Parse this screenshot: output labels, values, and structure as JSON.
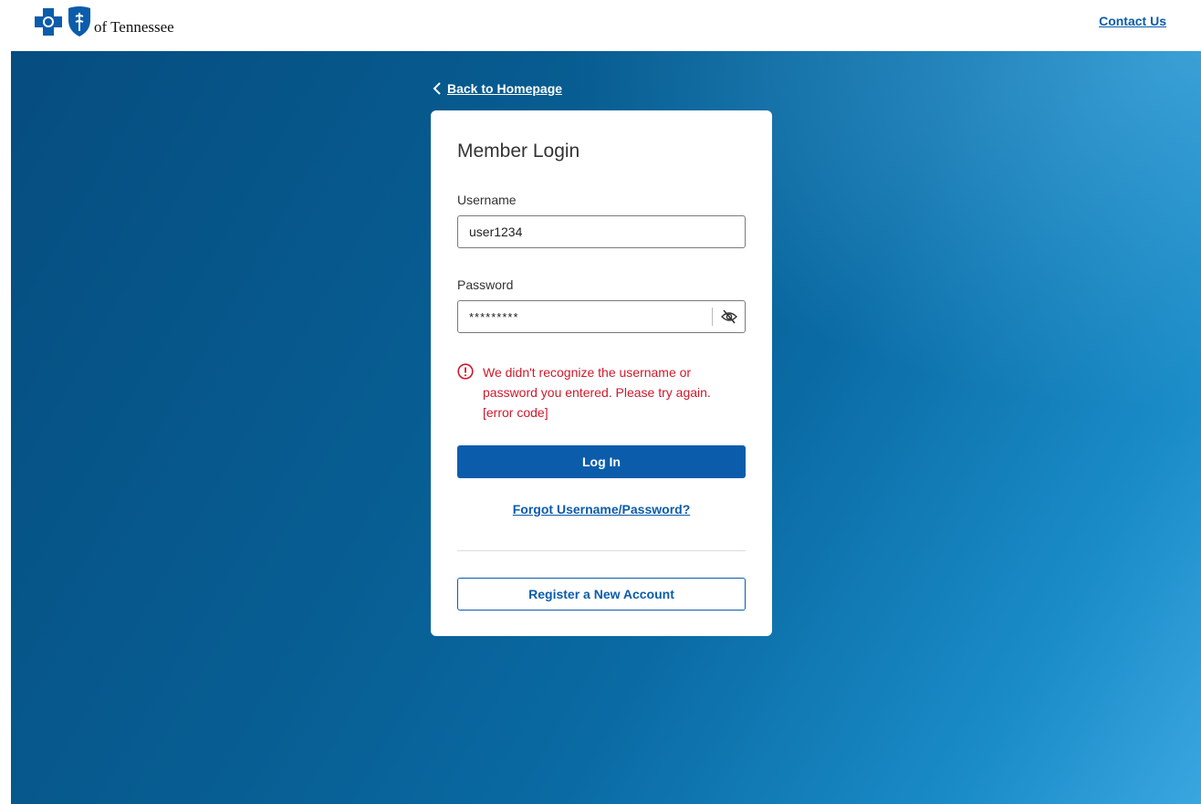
{
  "header": {
    "brand_text": "of Tennessee",
    "contact_label": "Contact Us"
  },
  "back_link": {
    "label": "Back to Homepage",
    "icon": "chevron-left-icon"
  },
  "login_card": {
    "title": "Member Login",
    "username": {
      "label": "Username",
      "value": "user1234"
    },
    "password": {
      "label": "Password",
      "value": "*********",
      "toggle_icon": "eye-slash-icon"
    },
    "error": {
      "icon": "alert-circle-icon",
      "lines": [
        "We didn't recognize the username or",
        "password you entered. Please try again.",
        "[error code]"
      ]
    },
    "login_label": "Log In",
    "forgot_label": "Forgot Username/Password?",
    "register_label": "Register a New Account"
  },
  "colors": {
    "brand_blue": "#0b5cab",
    "error_red": "#d0182b",
    "hero_dark": "#064d80",
    "hero_light": "#3aa6e0"
  }
}
